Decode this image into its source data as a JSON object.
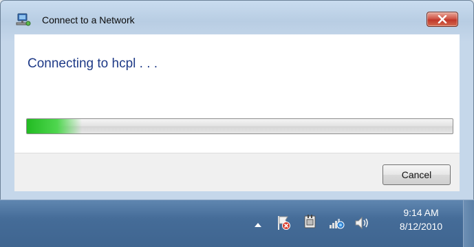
{
  "window": {
    "title": "Connect to a Network",
    "heading": "Connecting to hcpl . . .",
    "progress_fraction": 0.13,
    "cancel_label": "Cancel"
  },
  "taskbar": {
    "time": "9:14 AM",
    "date": "8/12/2010",
    "tray_icons": [
      "show-hidden-icons-arrow",
      "action-center-flag-icon",
      "power-plug-icon",
      "network-wifi-icon",
      "volume-icon"
    ]
  },
  "colors": {
    "heading": "#1e3a87",
    "progress_green": "#22bb22",
    "close_red": "#c0372a",
    "taskbar": "#456c98"
  }
}
